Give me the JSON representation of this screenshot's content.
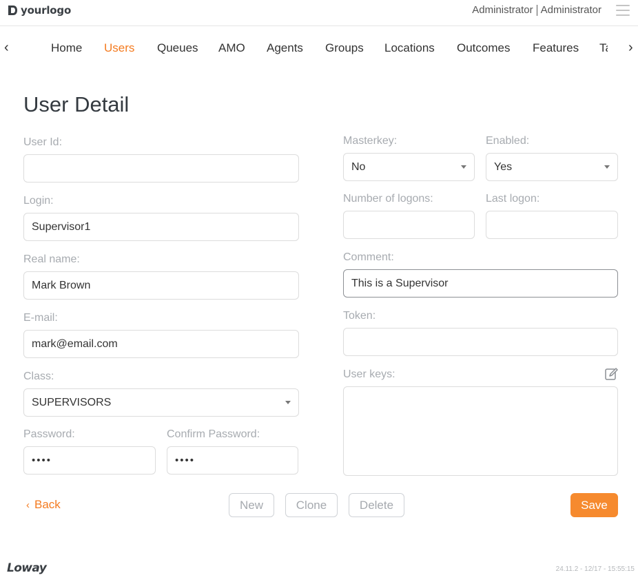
{
  "header": {
    "logo_text": "yourlogo",
    "user_role": "Administrator",
    "user_name": "Administrator"
  },
  "nav": {
    "items": [
      {
        "label": "Home",
        "active": false
      },
      {
        "label": "Users",
        "active": true
      },
      {
        "label": "Queues",
        "active": false
      },
      {
        "label": "AMO",
        "active": false
      },
      {
        "label": "Agents",
        "active": false
      },
      {
        "label": "Groups",
        "active": false
      },
      {
        "label": "Locations",
        "active": false
      },
      {
        "label": "Outcomes",
        "active": false
      },
      {
        "label": "Features",
        "active": false
      },
      {
        "label": "Ta",
        "active": false
      }
    ]
  },
  "page": {
    "title": "User Detail"
  },
  "form": {
    "user_id": {
      "label": "User Id:",
      "value": ""
    },
    "login": {
      "label": "Login:",
      "value": "Supervisor1"
    },
    "real_name": {
      "label": "Real name:",
      "value": "Mark Brown"
    },
    "email": {
      "label": "E-mail:",
      "value": "mark@email.com"
    },
    "class": {
      "label": "Class:",
      "value": "SUPERVISORS"
    },
    "password": {
      "label": "Password:",
      "value": "••••"
    },
    "confirm_password": {
      "label": "Confirm Password:",
      "value": "••••"
    },
    "masterkey": {
      "label": "Masterkey:",
      "value": "No"
    },
    "enabled": {
      "label": "Enabled:",
      "value": "Yes"
    },
    "logons": {
      "label": "Number of logons:",
      "value": ""
    },
    "last_logon": {
      "label": "Last logon:",
      "value": ""
    },
    "comment": {
      "label": "Comment:",
      "value": "This is a Supervisor"
    },
    "token": {
      "label": "Token:",
      "value": ""
    },
    "user_keys": {
      "label": "User keys:",
      "value": ""
    }
  },
  "actions": {
    "back_label": "Back",
    "new_label": "New",
    "clone_label": "Clone",
    "delete_label": "Delete",
    "save_label": "Save"
  },
  "footer": {
    "logo_text": "Loway",
    "version": "24.11.2 - 12/17 - 15:55:15"
  },
  "colors": {
    "accent": "#f47b20",
    "save_button": "#f68a2e",
    "label": "#a7abb0",
    "field_border": "#dcdcdc"
  },
  "icons": [
    "logo-mark-icon",
    "hamburger-icon",
    "chevron-left-icon",
    "chevron-right-icon",
    "caret-down-icon",
    "edit-icon"
  ]
}
